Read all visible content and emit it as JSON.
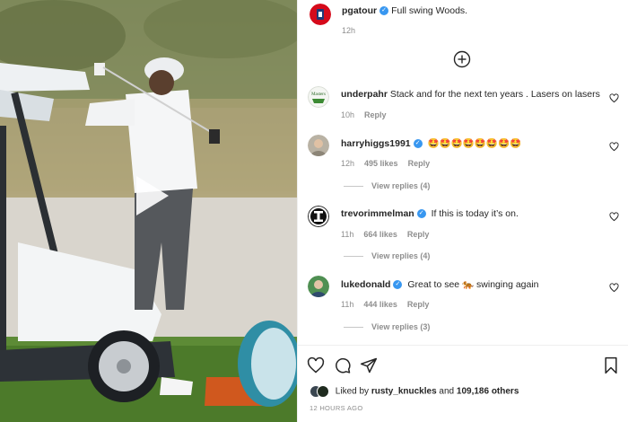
{
  "post": {
    "author": "pgatour",
    "caption": "Full swing Woods.",
    "time": "12h",
    "likes_prefix": "Liked by",
    "liked_by_user": "rusty_knuckles",
    "likes_joiner": "and",
    "likes_count": "109,186 others",
    "timestamp": "12 HOURS AGO"
  },
  "comments": [
    {
      "user": "underpahr",
      "verified": false,
      "text": "Stack and for the next ten years . Lasers on lasers",
      "time": "10h",
      "likes": "",
      "reply": "Reply",
      "view_replies": ""
    },
    {
      "user": "harryhiggs1991",
      "verified": true,
      "text": "🤩🤩🤩🤩🤩🤩🤩🤩",
      "time": "12h",
      "likes": "495 likes",
      "reply": "Reply",
      "view_replies": "View replies (4)"
    },
    {
      "user": "trevorimmelman",
      "verified": true,
      "text": "If this is today it’s on.",
      "time": "11h",
      "likes": "664 likes",
      "reply": "Reply",
      "view_replies": "View replies (4)"
    },
    {
      "user": "lukedonald",
      "verified": true,
      "text": "Great to see 🐅 swinging again",
      "time": "11h",
      "likes": "444 likes",
      "reply": "Reply",
      "view_replies": "View replies (3)"
    }
  ],
  "icons": {
    "load_more": "plus-circle-icon",
    "like": "heart-icon",
    "comment": "comment-icon",
    "share": "paper-plane-icon",
    "save": "bookmark-icon",
    "play": "play-icon"
  },
  "colors": {
    "verified": "#3897f0",
    "brand": "#d50a1b",
    "muted": "#8e8e8e"
  }
}
